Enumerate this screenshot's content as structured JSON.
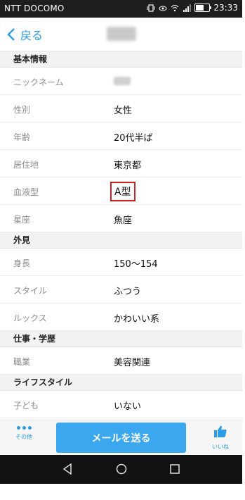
{
  "status_bar": {
    "carrier": "NTT DOCOMO",
    "time": "23:33",
    "battery_level": 0.6
  },
  "nav": {
    "back_label": "戻る"
  },
  "sections": [
    {
      "title": "基本情報",
      "rows": [
        {
          "label": "ニックネーム",
          "value": ""
        },
        {
          "label": "性別",
          "value": "女性"
        },
        {
          "label": "年齢",
          "value": "20代半ば"
        },
        {
          "label": "居住地",
          "value": "東京都"
        },
        {
          "label": "血液型",
          "value": "A型"
        },
        {
          "label": "星座",
          "value": "魚座"
        }
      ]
    },
    {
      "title": "外見",
      "rows": [
        {
          "label": "身長",
          "value": "150〜154"
        },
        {
          "label": "スタイル",
          "value": "ふつう"
        },
        {
          "label": "ルックス",
          "value": "かわいい系"
        }
      ]
    },
    {
      "title": "仕事・学歴",
      "rows": [
        {
          "label": "職業",
          "value": "美容関連"
        }
      ]
    },
    {
      "title": "ライフスタイル",
      "rows": [
        {
          "label": "子ども",
          "value": "いない"
        }
      ]
    }
  ],
  "actions": {
    "more_label": "その他",
    "send_label": "メールを送る",
    "like_label": "いいね"
  },
  "colors": {
    "accent": "#2b9ce8",
    "button": "#3aa7ef",
    "highlight_border": "#cc1f1f"
  }
}
